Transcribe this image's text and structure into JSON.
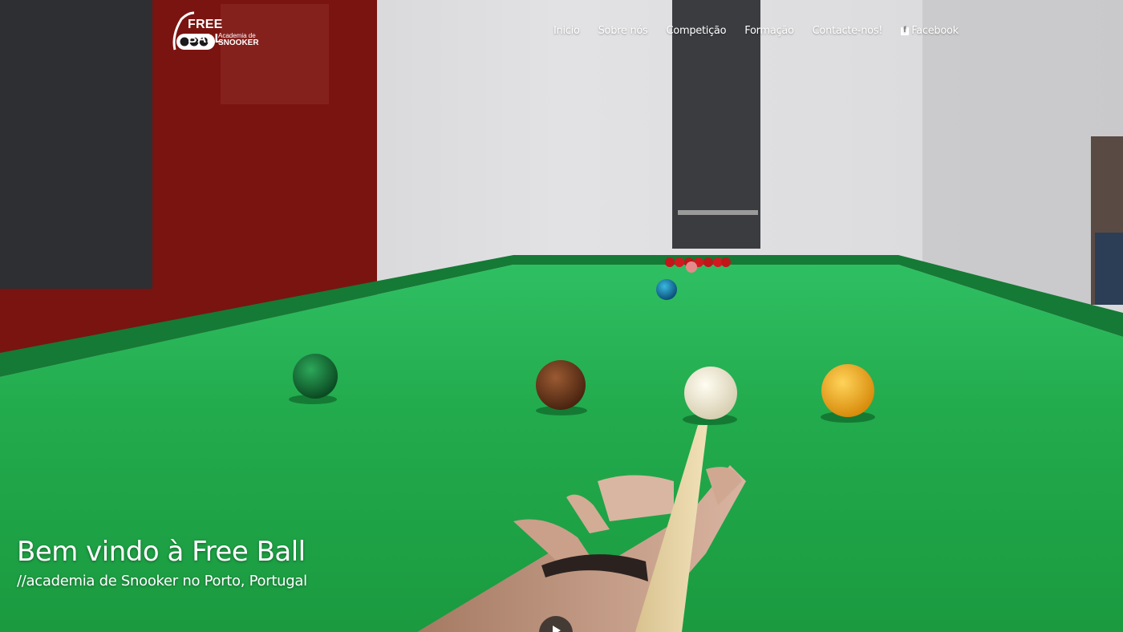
{
  "brand": {
    "name": "FREE BALL",
    "sub1": "Academia de",
    "sub2": "SNOOKER"
  },
  "nav": {
    "items": [
      {
        "label": "Inicio"
      },
      {
        "label": "Sobre nós"
      },
      {
        "label": "Competição"
      },
      {
        "label": "Formação"
      },
      {
        "label": "Contacte-nos!"
      },
      {
        "label": "Facebook",
        "icon": "facebook-icon"
      }
    ]
  },
  "hero": {
    "title": "Bem vindo à Free Ball",
    "subtitle": "//academia de Snooker no Porto, Portugal"
  },
  "colors": {
    "felt": "#1fa646",
    "wall_red": "#7a1410",
    "wall_grey": "#d8d8da",
    "text": "#ffffff"
  }
}
